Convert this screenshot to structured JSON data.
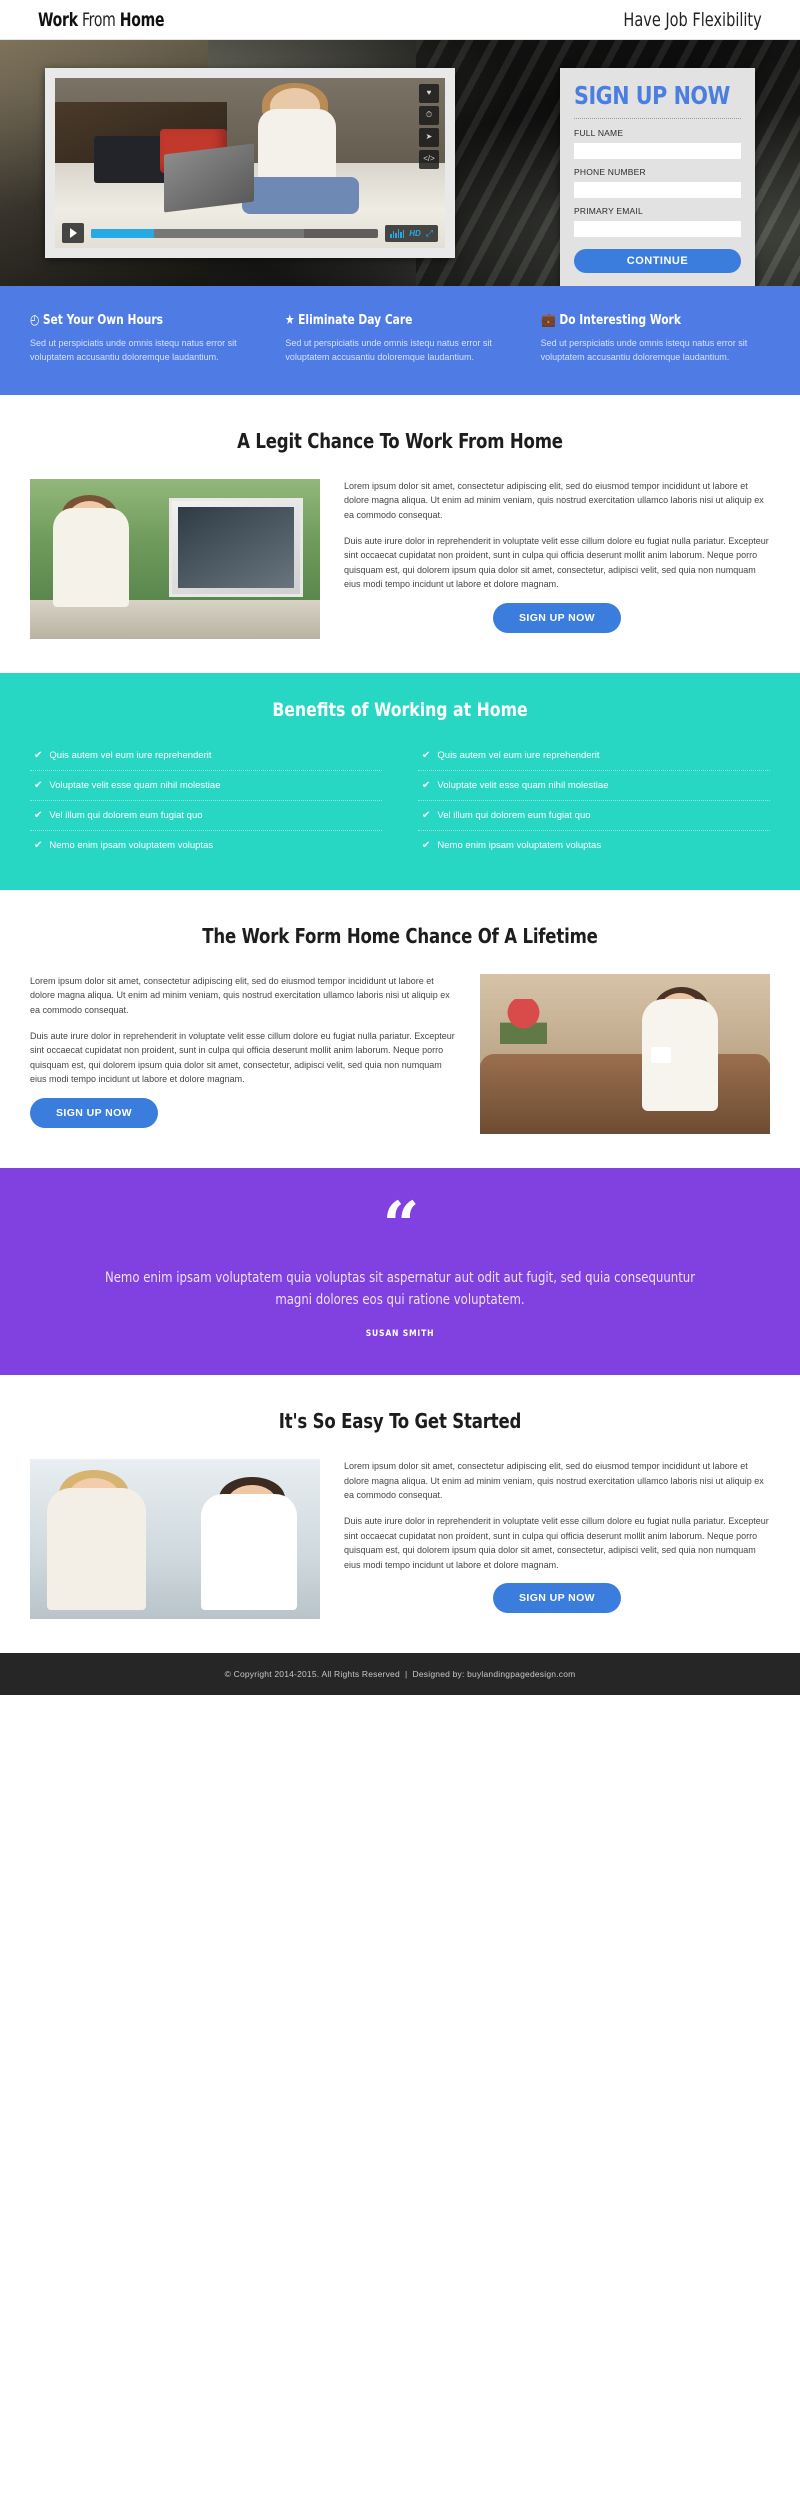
{
  "header": {
    "logo_bold1": "Work",
    "logo_light": " From ",
    "logo_bold2": "Home",
    "tagline": "Have Job Flexibility"
  },
  "hero": {
    "video": {
      "hd_label": "HD",
      "icons": [
        "fav",
        "later",
        "share",
        "embed"
      ]
    },
    "form": {
      "title": "SIGN UP NOW",
      "fields": [
        {
          "label": "FULL NAME",
          "value": "",
          "placeholder": ""
        },
        {
          "label": "PHONE NUMBER",
          "value": "",
          "placeholder": ""
        },
        {
          "label": "PRIMARY EMAIL",
          "value": "",
          "placeholder": ""
        }
      ],
      "submit_label": "CONTINUE"
    }
  },
  "features": [
    {
      "icon": "clock-icon",
      "glyph": "◴",
      "title": "Set Your Own Hours",
      "text": "Sed ut perspiciatis unde omnis istequ natus error sit voluptatem accusantiu doloremque laudantium."
    },
    {
      "icon": "star-icon",
      "glyph": "★",
      "title": "Eliminate Day Care",
      "text": "Sed ut perspiciatis unde omnis istequ natus error sit voluptatem accusantiu doloremque laudantium."
    },
    {
      "icon": "briefcase-icon",
      "glyph": "💼",
      "title": "Do Interesting Work",
      "text": "Sed ut perspiciatis unde omnis istequ natus error sit voluptatem accusantiu doloremque laudantium."
    }
  ],
  "section_legit": {
    "title": "A Legit Chance To Work From Home",
    "para1": "Lorem ipsum dolor sit amet, consectetur adipiscing elit, sed do eiusmod tempor incididunt ut labore et dolore magna aliqua. Ut enim ad minim veniam, quis nostrud exercitation ullamco laboris nisi ut aliquip ex ea commodo consequat.",
    "para2": "Duis aute irure dolor in reprehenderit in voluptate velit esse cillum dolore eu fugiat nulla pariatur. Excepteur sint occaecat cupidatat non proident, sunt in culpa qui officia deserunt mollit anim laborum. Neque porro quisquam est, qui dolorem ipsum quia dolor sit amet, consectetur, adipisci velit, sed quia non numquam eius modi tempo incidunt ut labore et dolore magnam.",
    "cta": "SIGN UP NOW"
  },
  "benefits": {
    "title": "Benefits of Working at Home",
    "check_glyph": "✔",
    "left": [
      "Quis autem vel eum iure reprehenderit",
      "Voluptate velit esse quam nihil molestiae",
      "Vel illum qui dolorem eum fugiat quo",
      "Nemo enim ipsam voluptatem voluptas"
    ],
    "right": [
      "Quis autem vel eum iure reprehenderit",
      "Voluptate velit esse quam nihil molestiae",
      "Vel illum qui dolorem eum fugiat quo",
      "Nemo enim ipsam voluptatem voluptas"
    ]
  },
  "section_lifetime": {
    "title": "The Work Form Home Chance Of A Lifetime",
    "para1": "Lorem ipsum dolor sit amet, consectetur adipiscing elit, sed do eiusmod tempor incididunt ut labore et dolore magna aliqua. Ut enim ad minim veniam, quis nostrud exercitation ullamco laboris nisi ut aliquip ex ea commodo consequat.",
    "para2": "Duis aute irure dolor in reprehenderit in voluptate velit esse cillum dolore eu fugiat nulla pariatur. Excepteur sint occaecat cupidatat non proident, sunt in culpa qui officia deserunt mollit anim laborum. Neque porro quisquam est, qui dolorem ipsum quia dolor sit amet, consectetur, adipisci velit, sed quia non numquam eius modi tempo incidunt ut labore et dolore magnam.",
    "cta": "SIGN UP NOW"
  },
  "testimonial": {
    "quote_glyph": "“",
    "text": "Nemo enim ipsam voluptatem quia voluptas sit aspernatur aut odit aut fugit, sed quia consequuntur magni dolores eos qui ratione voluptatem.",
    "author": "SUSAN SMITH"
  },
  "section_started": {
    "title": "It's So Easy To Get Started",
    "para1": "Lorem ipsum dolor sit amet, consectetur adipiscing elit, sed do eiusmod tempor incididunt ut labore et dolore magna aliqua. Ut enim ad minim veniam, quis nostrud exercitation ullamco laboris nisi ut aliquip ex ea commodo consequat.",
    "para2": "Duis aute irure dolor in reprehenderit in voluptate velit esse cillum dolore eu fugiat nulla pariatur. Excepteur sint occaecat cupidatat non proident, sunt in culpa qui officia deserunt mollit anim laborum. Neque porro quisquam est, qui dolorem ipsum quia dolor sit amet, consectetur, adipisci velit, sed quia non numquam eius modi tempo incidunt ut labore et dolore magnam.",
    "cta": "SIGN UP NOW"
  },
  "footer": {
    "text": "© Copyright 2014-2015. All Rights Reserved  |  Designed by: buylandingpagedesign.com"
  },
  "colors": {
    "primary_blue": "#3b7ddd",
    "feature_blue": "#4f7ce4",
    "teal": "#27d7c4",
    "purple": "#8140e0",
    "footer_dark": "#262626"
  }
}
